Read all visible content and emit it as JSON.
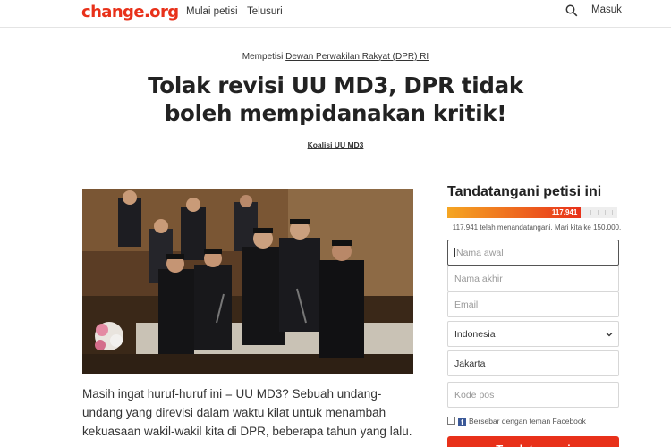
{
  "header": {
    "logo": "change.org",
    "nav": {
      "start_petition": "Mulai petisi",
      "browse": "Telusuri"
    },
    "login": "Masuk",
    "icons": {
      "search": "search-icon"
    },
    "colors": {
      "brand": "#e8311a"
    }
  },
  "petition": {
    "to_prefix": "Mempetisi",
    "to_target": "Dewan Perwakilan Rakyat (DPR) RI",
    "title": "Tolak revisi UU MD3, DPR tidak boleh mempidanakan kritik!",
    "author": "Koalisi UU MD3",
    "body": "Masih ingat huruf-huruf ini = UU MD3? Sebuah undang-undang yang direvisi dalam waktu kilat untuk menambah kekuasaan wakil-wakil kita di DPR, beberapa tahun yang lalu."
  },
  "sign_panel": {
    "title": "Tandatangani petisi ini",
    "progress": {
      "count_label": "117.941",
      "signed": 117941,
      "goal": 150000,
      "fraction": 0.786
    },
    "count_text": "117.941 telah menandatangani. Mari kita ke 150.000.",
    "fields": {
      "first_name_placeholder": "Nama awal",
      "last_name_placeholder": "Nama akhir",
      "email_placeholder": "Email",
      "country_value": "Indonesia",
      "city_value": "Jakarta",
      "postal_placeholder": "Kode pos"
    },
    "share_facebook": "Bersebar dengan teman Facebook",
    "sign_button": "Tandatangani"
  }
}
